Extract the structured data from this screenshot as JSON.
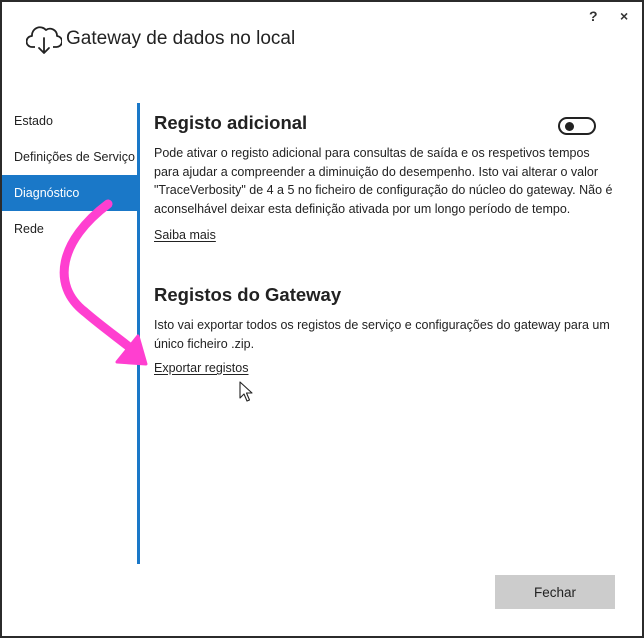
{
  "window": {
    "title": "Gateway de dados no local",
    "help": "?",
    "close": "×"
  },
  "sidebar": {
    "items": [
      {
        "label": "Estado",
        "active": false
      },
      {
        "label": "Definições de Serviço",
        "active": false
      },
      {
        "label": "Diagnóstico",
        "active": true
      },
      {
        "label": "Rede",
        "active": false
      }
    ]
  },
  "sections": {
    "logging": {
      "title": "Registo adicional",
      "toggle_on": false,
      "text_lines": [
        "Pode ativar o registo adicional para consultas de saída e os respetivos tempos",
        "para ajudar a compreender a diminuição do desempenho. Isto vai alterar o valor",
        "\"TraceVerbosity\" de 4 a 5 no ficheiro de configuração do núcleo do gateway. Não é",
        "aconselhável deixar esta definição ativada por um longo período de tempo."
      ],
      "link": "Saiba mais"
    },
    "gateway_logs": {
      "title": "Registos do Gateway",
      "text_lines": [
        "Isto vai exportar todos os registos de serviço e configurações do gateway para um",
        "único ficheiro .zip."
      ],
      "link": "Exportar registos"
    }
  },
  "footer": {
    "close_label": "Fechar"
  },
  "colors": {
    "accent": "#1a78c8",
    "annotation_arrow": "#ff3fd0",
    "button_bg": "#cccccc"
  },
  "icons": {
    "app": "cloud-upload-icon",
    "cursor": "mouse-pointer-icon"
  }
}
